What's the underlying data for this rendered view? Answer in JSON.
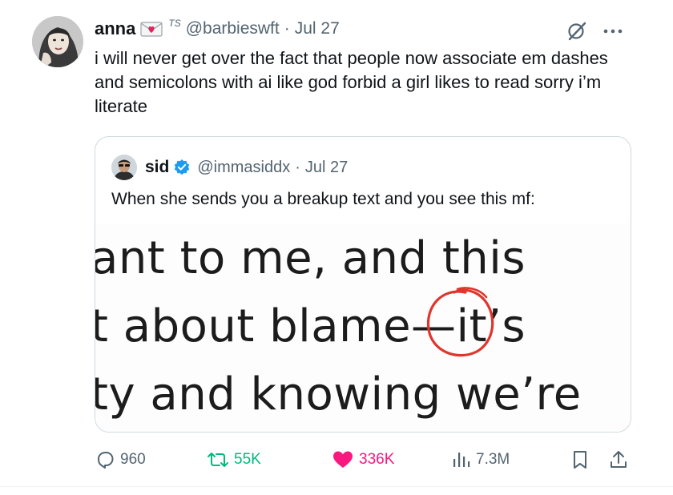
{
  "tweet": {
    "author_name": "anna",
    "name_emoji": "love-letter-icon",
    "name_suffix": "TS",
    "handle": "@barbieswft",
    "separator": "·",
    "date": "Jul 27",
    "text": "i will never get over the fact that people now associate em dashes and semicolons with ai like god forbid a girl likes to read sorry i’m literate"
  },
  "quote": {
    "author_name": "sid",
    "verified": true,
    "handle": "@immasiddx",
    "separator": "·",
    "date": "Jul 27",
    "text": "When she sends you a breakup text and you see this mf:",
    "image_lines": [
      "ant to me, and this",
      "t about blame—it’s",
      "ty and knowing we’re"
    ]
  },
  "actions": {
    "replies": "960",
    "retweets": "55K",
    "likes": "336K",
    "views": "7.3M"
  },
  "icons": {
    "grok": "grok-icon",
    "more": "more-icon",
    "reply": "reply-icon",
    "retweet": "retweet-icon",
    "like": "heart-icon",
    "views": "views-icon",
    "bookmark": "bookmark-icon",
    "share": "share-icon",
    "verified": "verified-badge-icon"
  },
  "colors": {
    "text": "#0f1419",
    "secondary": "#536471",
    "retweet_green": "#00ba7c",
    "like_pink": "#f91880",
    "verified_blue": "#1d9bf0",
    "circle_red": "#e0352b",
    "border": "#cfd9de"
  }
}
